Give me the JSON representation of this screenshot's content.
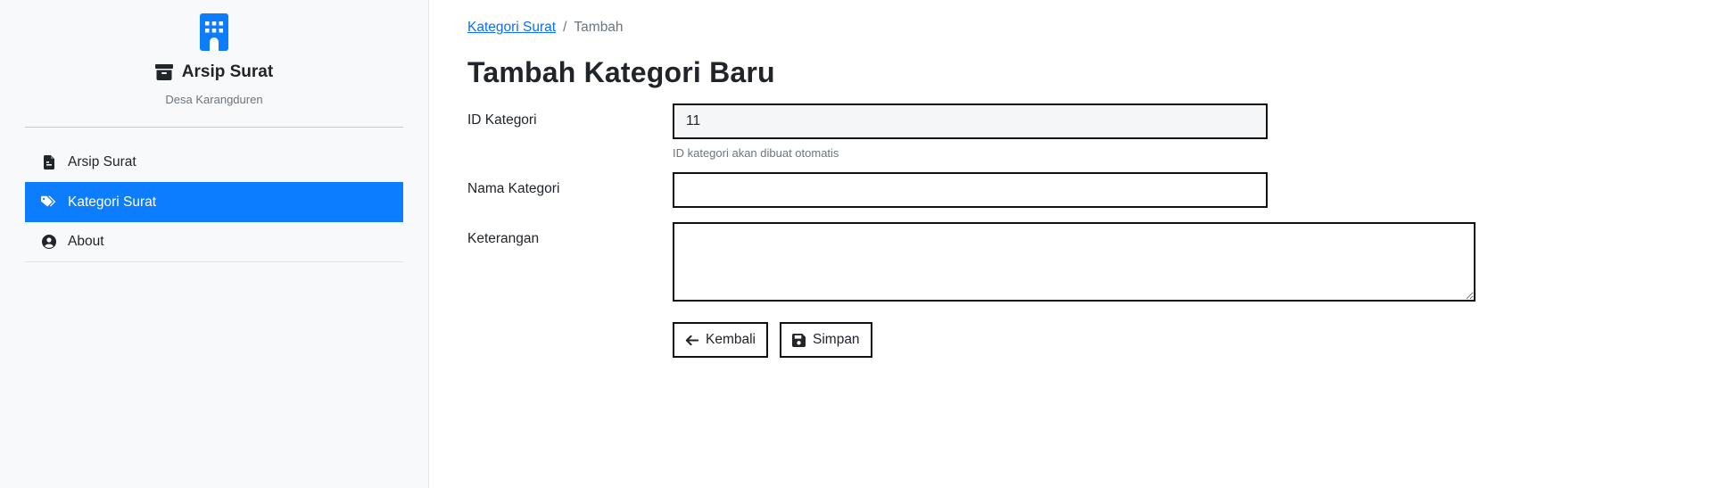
{
  "sidebar": {
    "app_name": "Arsip Surat",
    "subtitle": "Desa Karangduren",
    "items": [
      {
        "label": "Arsip Surat",
        "icon": "file-icon",
        "active": false
      },
      {
        "label": "Kategori Surat",
        "icon": "tags-icon",
        "active": true
      },
      {
        "label": "About",
        "icon": "user-circle-icon",
        "active": false
      }
    ]
  },
  "breadcrumb": {
    "parent": "Kategori Surat",
    "separator": "/",
    "current": "Tambah"
  },
  "page_title": "Tambah Kategori Baru",
  "form": {
    "id_label": "ID Kategori",
    "id_value": "11",
    "id_help": "ID kategori akan dibuat otomatis",
    "name_label": "Nama Kategori",
    "name_value": "",
    "desc_label": "Keterangan",
    "desc_value": ""
  },
  "buttons": {
    "back_label": "Kembali",
    "save_label": "Simpan"
  },
  "colors": {
    "accent": "#0d7dff",
    "link": "#0d6efd",
    "sidebar_bg": "#f8f9fa"
  }
}
